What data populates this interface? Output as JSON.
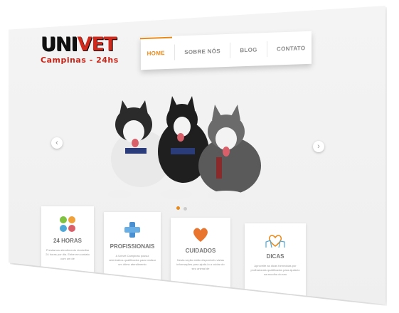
{
  "logo": {
    "main_pre": "UNI",
    "main_post": "VET",
    "sub": "Campinas - 24hs"
  },
  "nav": {
    "items": [
      {
        "label": "HOME",
        "active": true
      },
      {
        "label": "SOBRE NÓS",
        "active": false
      },
      {
        "label": "BLOG",
        "active": false
      },
      {
        "label": "CONTATO",
        "active": false
      }
    ]
  },
  "slider": {
    "prev_icon": "chevron-left-icon",
    "next_icon": "chevron-right-icon",
    "prev_glyph": "‹",
    "next_glyph": "›",
    "slide_count": 2,
    "active_slide": 1,
    "image": "three-husky-dogs"
  },
  "cards": [
    {
      "title": "24 HORAS",
      "text": "Prestamos atendimento domiciliar 24 horas por dia. Entre em contato com um de",
      "icon": "pets-colors-icon"
    },
    {
      "title": "PROFISSIONAIS",
      "text": "A Univet Campinas possui veterinários qualificados para realizar um ótimo atendimento",
      "icon": "medical-cross-icon"
    },
    {
      "title": "CUIDADOS",
      "text": "Nesta seção estão disponíveis várias informações para ajudá-lo a cuidar do seu animal de",
      "icon": "heart-hands-icon"
    },
    {
      "title": "DICAS",
      "text": "Aproveite as dicas fornecidas por profissionais qualificados para ajudá-lo na escolha do seu",
      "icon": "pets-outline-icon"
    }
  ],
  "colors": {
    "accent": "#e88a1a",
    "logo_red": "#d12a1d"
  }
}
